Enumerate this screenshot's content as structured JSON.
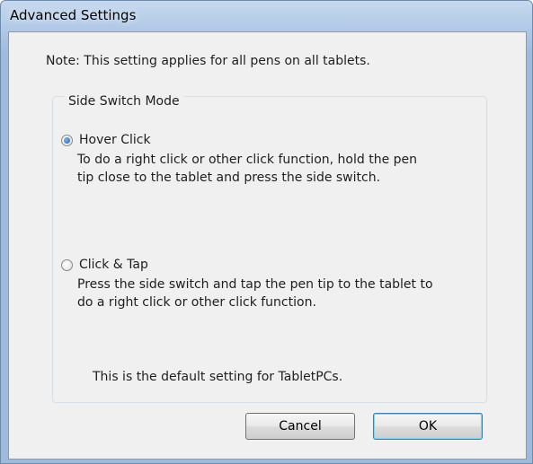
{
  "window": {
    "title": "Advanced Settings"
  },
  "note": "Note: This setting applies for all pens on all tablets.",
  "side_switch_mode": {
    "label": "Side Switch Mode",
    "options": [
      {
        "label": "Hover Click",
        "checked": true,
        "description_line1": "To do a right click or other click function, hold the pen",
        "description_line2": "tip close to the tablet and press the side switch."
      },
      {
        "label": "Click & Tap",
        "checked": false,
        "description_line1": "Press the side switch and tap the pen tip to the tablet to",
        "description_line2": "do a right click or other click function."
      }
    ],
    "default_note": "This is the default setting for TabletPCs."
  },
  "buttons": {
    "cancel": "Cancel",
    "ok": "OK"
  },
  "colors": {
    "titlebar": "#b6cde9",
    "dialog_background": "#f0f0f0",
    "radio_selected": "#1d5fb5"
  }
}
